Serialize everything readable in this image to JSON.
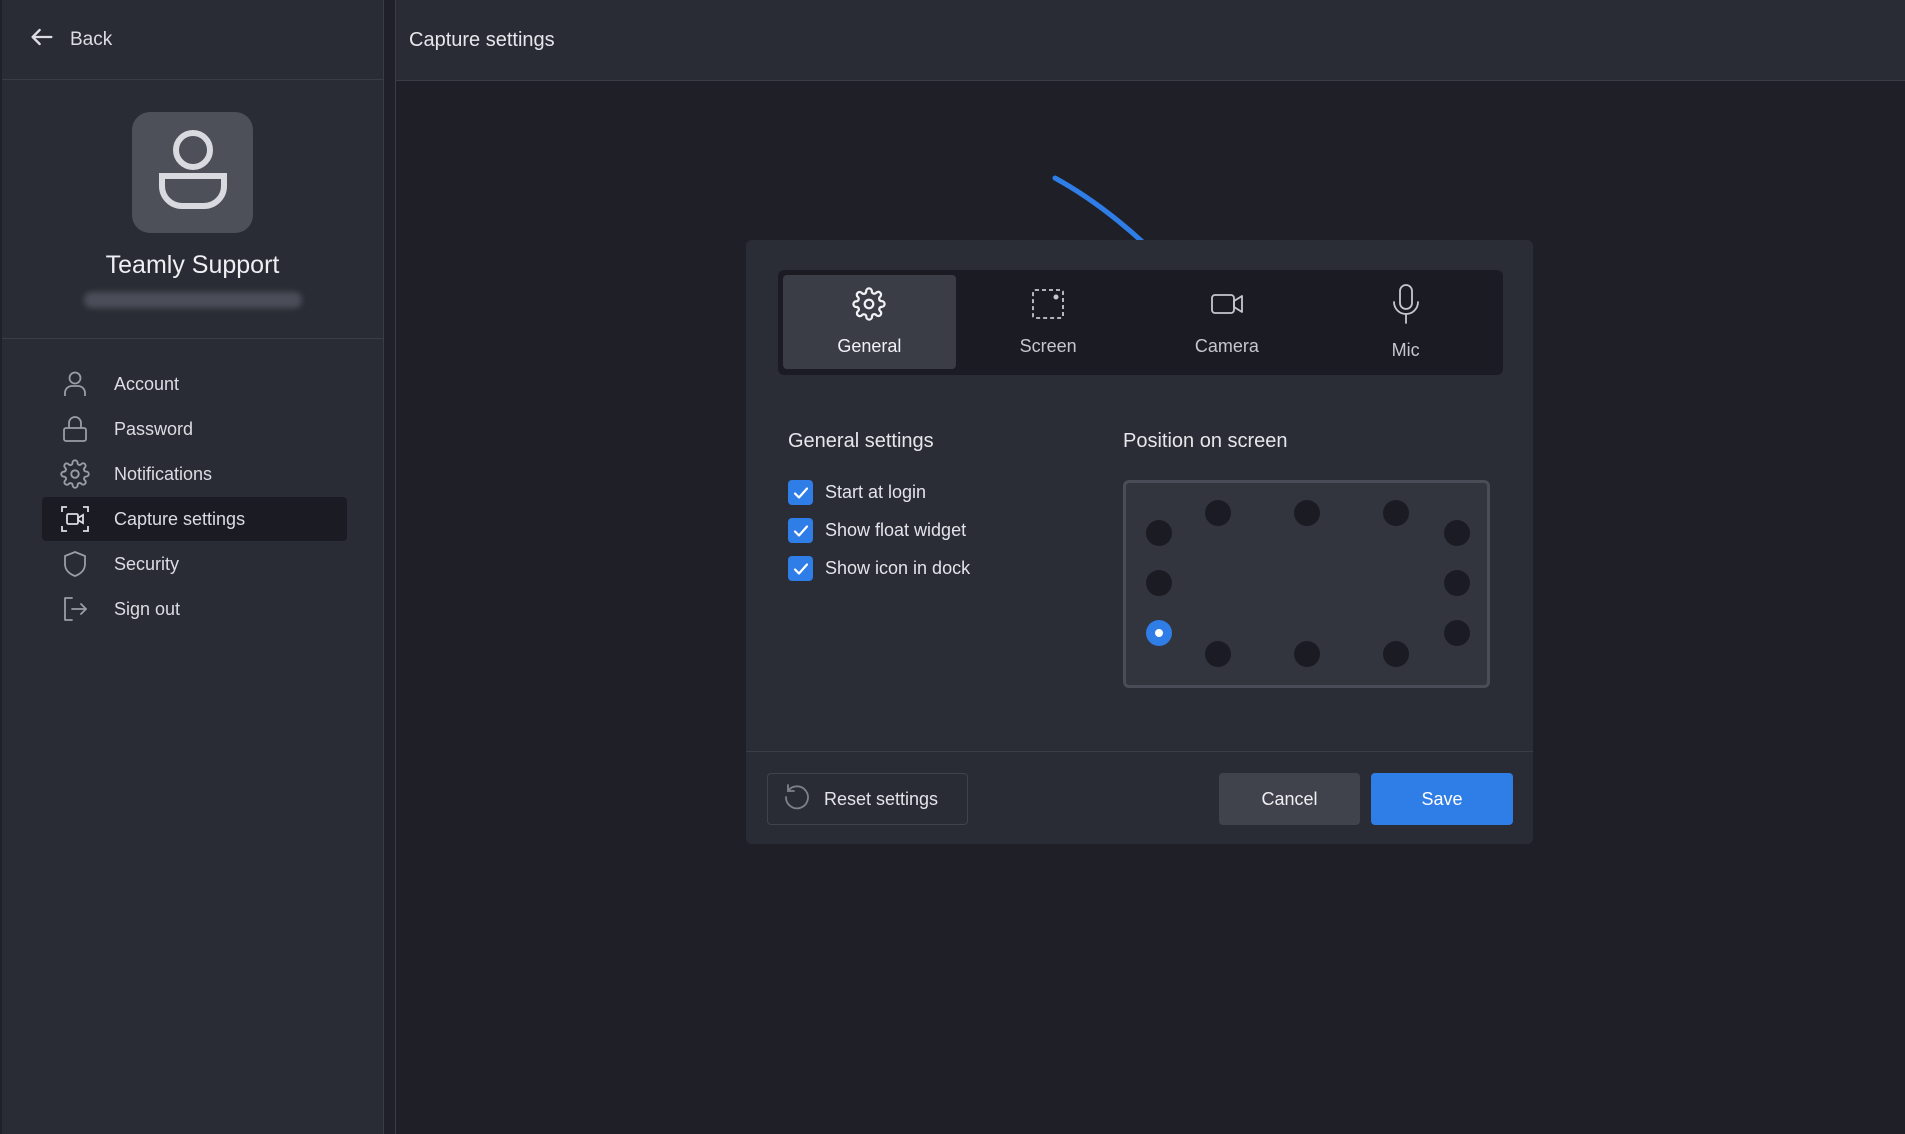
{
  "sidebar": {
    "back_label": "Back",
    "profile": {
      "name": "Teamly Support"
    },
    "items": [
      {
        "label": "Account",
        "icon": "user-icon"
      },
      {
        "label": "Password",
        "icon": "lock-icon"
      },
      {
        "label": "Notifications",
        "icon": "gear-icon"
      },
      {
        "label": "Capture settings",
        "icon": "capture-icon",
        "active": true
      },
      {
        "label": "Security",
        "icon": "shield-icon"
      },
      {
        "label": "Sign out",
        "icon": "sign-out-icon"
      }
    ]
  },
  "header": {
    "title": "Capture settings"
  },
  "dialog": {
    "tabs": [
      {
        "label": "General",
        "icon": "gear-icon",
        "active": true
      },
      {
        "label": "Screen",
        "icon": "screen-select-icon"
      },
      {
        "label": "Camera",
        "icon": "camera-icon"
      },
      {
        "label": "Mic",
        "icon": "microphone-icon"
      }
    ],
    "general": {
      "title": "General settings",
      "options": [
        {
          "label": "Start at login",
          "checked": true
        },
        {
          "label": "Show float widget",
          "checked": true
        },
        {
          "label": "Show icon in dock",
          "checked": true
        }
      ]
    },
    "position": {
      "title": "Position on screen",
      "selected": "bottom-left"
    },
    "footer": {
      "reset_label": "Reset settings",
      "cancel_label": "Cancel",
      "save_label": "Save"
    }
  },
  "colors": {
    "accent": "#2f7de6",
    "background": "#1e1f27",
    "panel": "#2b2d36"
  }
}
